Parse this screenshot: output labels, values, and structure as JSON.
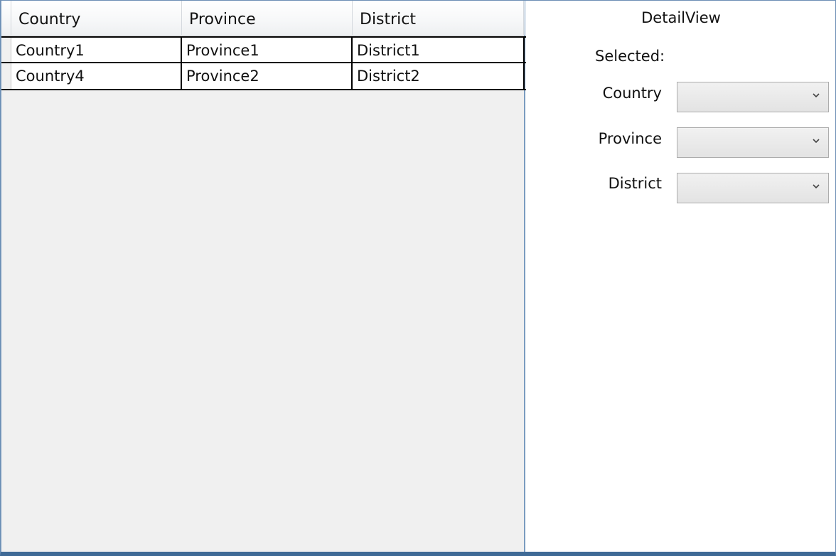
{
  "grid": {
    "columns": [
      "Country",
      "Province",
      "District"
    ],
    "rows": [
      [
        "Country1",
        "Province1",
        "District1"
      ],
      [
        "Country4",
        "Province2",
        "District2"
      ]
    ]
  },
  "detail": {
    "title": "DetailView",
    "selected_label": "Selected:",
    "fields": [
      {
        "label": "Country",
        "value": ""
      },
      {
        "label": "Province",
        "value": ""
      },
      {
        "label": "District",
        "value": ""
      }
    ],
    "dropdown_icon": "chevron-down-icon"
  },
  "colors": {
    "window_border": "#3f6a96",
    "grid_background": "#f0f0f0",
    "combo_border": "#acacac"
  }
}
